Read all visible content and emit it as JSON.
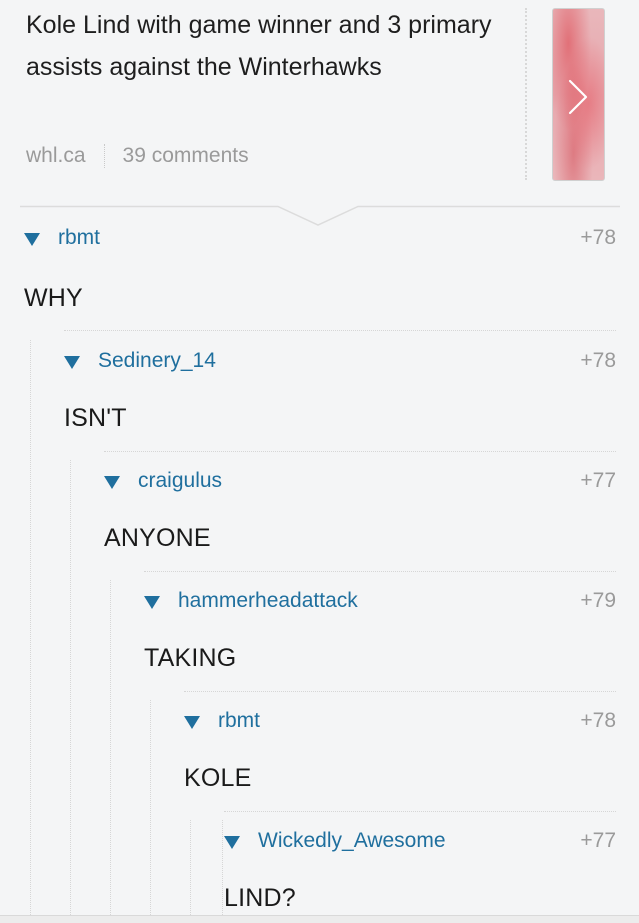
{
  "post": {
    "title": "Kole Lind with game winner and 3 primary assists against the Winterhawks",
    "domain": "whl.ca",
    "comments": "39 comments",
    "thumbnail_icon": "chevron-right-icon"
  },
  "colors": {
    "username": "#1f6f9e",
    "score": "#9a9a9a",
    "background": "#f4f5f6"
  },
  "comments": [
    {
      "username": "rbmt",
      "score": "+78",
      "body": "WHY",
      "collapse_icon": "triangle-down-icon"
    },
    {
      "username": "Sedinery_14",
      "score": "+78",
      "body": "ISN'T",
      "collapse_icon": "triangle-down-icon"
    },
    {
      "username": "craigulus",
      "score": "+77",
      "body": "ANYONE",
      "collapse_icon": "triangle-down-icon"
    },
    {
      "username": "hammerheadattack",
      "score": "+79",
      "body": "TAKING",
      "collapse_icon": "triangle-down-icon"
    },
    {
      "username": "rbmt",
      "score": "+78",
      "body": "KOLE",
      "collapse_icon": "triangle-down-icon"
    },
    {
      "username": "Wickedly_Awesome",
      "score": "+77",
      "body": "LIND?",
      "collapse_icon": "triangle-down-icon"
    }
  ]
}
